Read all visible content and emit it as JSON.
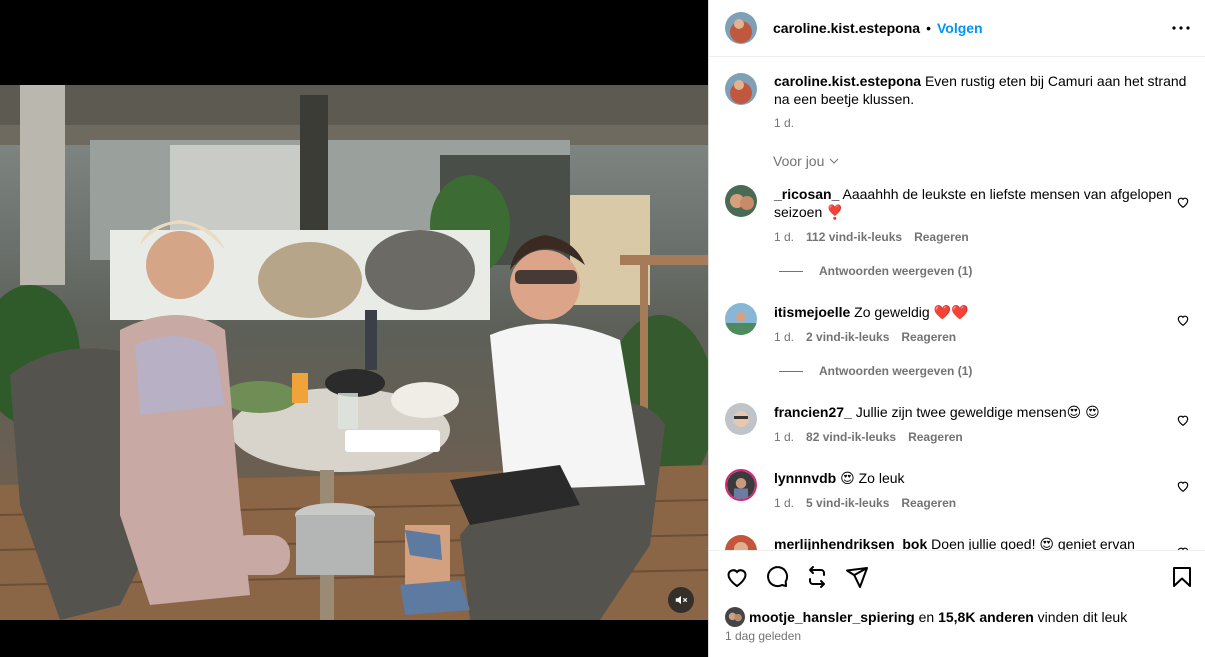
{
  "header": {
    "username": "caroline.kist.estepona",
    "separator": "•",
    "follow_label": "Volgen",
    "more_icon": "more-horizontal-icon"
  },
  "caption": {
    "username": "caroline.kist.estepona",
    "text": "Even rustig eten bij Camuri aan het strand na een beetje klussen.",
    "time": "1 d."
  },
  "filter_label": "Voor jou",
  "comments": [
    {
      "username": "_ricosan_",
      "text": "Aaaahhh de leukste en liefste mensen van afgelopen seizoen ❣️",
      "time": "1 d.",
      "likes": "112 vind-ik-leuks",
      "reply": "Reageren",
      "view_replies": "Antwoorden weergeven (1)"
    },
    {
      "username": "itismejoelle",
      "text": "Zo geweldig ❤️❤️",
      "time": "1 d.",
      "likes": "2 vind-ik-leuks",
      "reply": "Reageren",
      "view_replies": "Antwoorden weergeven (1)"
    },
    {
      "username": "francien27_",
      "text": "Jullie zijn twee geweldige mensen😍 😍",
      "time": "1 d.",
      "likes": "82 vind-ik-leuks",
      "reply": "Reageren"
    },
    {
      "username": "lynnnvdb",
      "text": "😍 Zo leuk",
      "time": "1 d.",
      "likes": "5 vind-ik-leuks",
      "reply": "Reageren"
    },
    {
      "username": "merlijnhendriksen_bok",
      "text": "Doen jullie goed! 😍 geniet ervan"
    }
  ],
  "actions": {
    "like_icon": "heart-icon",
    "comment_icon": "comment-icon",
    "repost_icon": "repost-icon",
    "share_icon": "share-icon",
    "save_icon": "bookmark-icon"
  },
  "likes_line": {
    "user": "mootje_hansler_spiering",
    "connector": " en ",
    "others": "15,8K anderen",
    "suffix": " vinden dit leuk"
  },
  "posted_ago": "1 dag geleden",
  "media": {
    "mute_icon": "speaker-muted-icon"
  },
  "colors": {
    "accent": "#0095f6",
    "muted_text": "#737373",
    "border": "#dbdbdb"
  }
}
